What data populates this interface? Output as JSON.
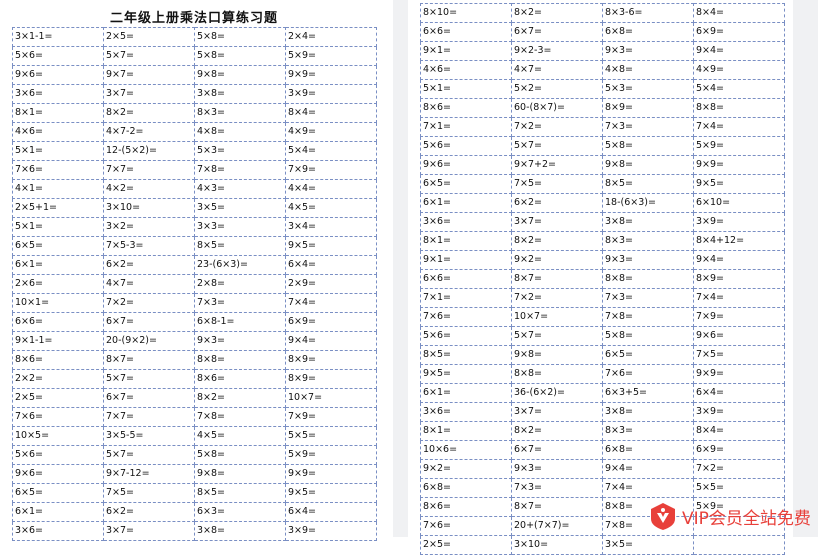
{
  "left_page": {
    "title": "二年级上册乘法口算练习题",
    "rows": [
      [
        "3×1-1=",
        "2×5=",
        "5×8=",
        "2×4="
      ],
      [
        "5×6=",
        "5×7=",
        "5×8=",
        "5×9="
      ],
      [
        "9×6=",
        "9×7=",
        "9×8=",
        "9×9="
      ],
      [
        "3×6=",
        "3×7=",
        "3×8=",
        "3×9="
      ],
      [
        "8×1=",
        "8×2=",
        "8×3=",
        "8×4="
      ],
      [
        "4×6=",
        "4×7-2=",
        "4×8=",
        "4×9="
      ],
      [
        "5×1=",
        "12-(5×2)=",
        "5×3=",
        "5×4="
      ],
      [
        "7×6=",
        "7×7=",
        "7×8=",
        "7×9="
      ],
      [
        "4×1=",
        "4×2=",
        "4×3=",
        "4×4="
      ],
      [
        "2×5+1=",
        "3×10=",
        "3×5=",
        "4×5="
      ],
      [
        "5×1=",
        "3×2=",
        "3×3=",
        "3×4="
      ],
      [
        "6×5=",
        "7×5-3=",
        "8×5=",
        "9×5="
      ],
      [
        "6×1=",
        "6×2=",
        "23-(6×3)=",
        "6×4="
      ],
      [
        "2×6=",
        "4×7=",
        "2×8=",
        "2×9="
      ],
      [
        "10×1=",
        "7×2=",
        "7×3=",
        "7×4="
      ],
      [
        "6×6=",
        "6×7=",
        "6×8-1=",
        "6×9="
      ],
      [
        "9×1-1=",
        "20-(9×2)=",
        "9×3=",
        "9×4="
      ],
      [
        "8×6=",
        "8×7=",
        "8×8=",
        "8×9="
      ],
      [
        "2×2=",
        "5×7=",
        "8×6=",
        "8×9="
      ],
      [
        "2×5=",
        "6×7=",
        "8×2=",
        "10×7="
      ],
      [
        "7×6=",
        "7×7=",
        "7×8=",
        "7×9="
      ],
      [
        "10×5=",
        "3×5-5=",
        "4×5=",
        "5×5="
      ],
      [
        "5×6=",
        "5×7=",
        "5×8=",
        "5×9="
      ],
      [
        "9×6=",
        "9×7-12=",
        "9×8=",
        "9×9="
      ],
      [
        "6×5=",
        "7×5=",
        "8×5=",
        "9×5="
      ],
      [
        "6×1=",
        "6×2=",
        "6×3=",
        "6×4="
      ],
      [
        "3×6=",
        "3×7=",
        "3×8=",
        "3×9="
      ]
    ]
  },
  "right_page": {
    "rows": [
      [
        "8×10=",
        "8×2=",
        "8×3-6=",
        "8×4="
      ],
      [
        "6×6=",
        "6×7=",
        "6×8=",
        "6×9="
      ],
      [
        "9×1=",
        "9×2-3=",
        "9×3=",
        "9×4="
      ],
      [
        "4×6=",
        "4×7=",
        "4×8=",
        "4×9="
      ],
      [
        "5×1=",
        "5×2=",
        "5×3=",
        "5×4="
      ],
      [
        "8×6=",
        "60-(8×7)=",
        "8×9=",
        "8×8="
      ],
      [
        "7×1=",
        "7×2=",
        "7×3=",
        "7×4="
      ],
      [
        "5×6=",
        "5×7=",
        "5×8=",
        "5×9="
      ],
      [
        "9×6=",
        "9×7+2=",
        "9×8=",
        "9×9="
      ],
      [
        "6×5=",
        "7×5=",
        "8×5=",
        "9×5="
      ],
      [
        "6×1=",
        "6×2=",
        "18-(6×3)=",
        "6×10="
      ],
      [
        "3×6=",
        "3×7=",
        "3×8=",
        "3×9="
      ],
      [
        "8×1=",
        "8×2=",
        "8×3=",
        "8×4+12="
      ],
      [
        "9×1=",
        "9×2=",
        "9×3=",
        "9×4="
      ],
      [
        "6×6=",
        "8×7=",
        "8×8=",
        "8×9="
      ],
      [
        "7×1=",
        "7×2=",
        "7×3=",
        "7×4="
      ],
      [
        "7×6=",
        "10×7=",
        "7×8=",
        "7×9="
      ],
      [
        "5×6=",
        "5×7=",
        "5×8=",
        "9×6="
      ],
      [
        "8×5=",
        "9×8=",
        "6×5=",
        "7×5="
      ],
      [
        "9×5=",
        "8×8=",
        "7×6=",
        "9×9="
      ],
      [
        "6×1=",
        "36-(6×2)=",
        "6×3+5=",
        "6×4="
      ],
      [
        "3×6=",
        "3×7=",
        "3×8=",
        "3×9="
      ],
      [
        "8×1=",
        "8×2=",
        "8×3=",
        "8×4="
      ],
      [
        "10×6=",
        "6×7=",
        "6×8=",
        "6×9="
      ],
      [
        "9×2=",
        "9×3=",
        "9×4=",
        "7×2="
      ],
      [
        "6×8=",
        "7×3=",
        "7×4=",
        "5×5="
      ],
      [
        "8×6=",
        "8×7=",
        "8×8=",
        "5×9="
      ],
      [
        "7×6=",
        "20+(7×7)=",
        "7×8=",
        ""
      ],
      [
        "2×5=",
        "3×10=",
        "3×5=",
        ""
      ]
    ]
  },
  "watermark": {
    "text": "VIP会员全站免费",
    "icon": "vip-badge-icon",
    "color": "#e8403a"
  }
}
